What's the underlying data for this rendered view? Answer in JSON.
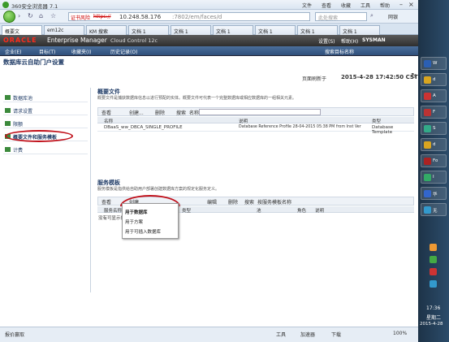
{
  "browser": {
    "title": "360安全浏览器 7.1",
    "menus": [
      "文件",
      "查看",
      "收藏",
      "工具",
      "帮助"
    ],
    "url_warning": "证书风险",
    "url_scheme": "https://",
    "url_host": "10.248.58.176",
    "url_rest": ":7802/em/faces/d",
    "search_placeholder": "此处搜索",
    "speed_label": "网银"
  },
  "tabs": [
    "概要文",
    "em12c",
    "KM 搜索",
    "文档 1",
    "文档 1",
    "文档 1",
    "文档 1",
    "文档 1",
    "文档 1"
  ],
  "oracle": {
    "logo": "ORACLE",
    "product": "Enterprise Manager",
    "edition": "Cloud Control 12c",
    "settings": "设置(S)",
    "help": "帮助(H)",
    "user": "SYSMAN",
    "search_target": "搜索目标名称"
  },
  "menu": {
    "enterprise": "企业(E)",
    "targets": "目标(T)",
    "favorites": "收藏夹(I)",
    "history": "历史记录(O)"
  },
  "page": {
    "title": "数据库云自助门户设置",
    "refresh_label": "页面刷新于",
    "refresh_time": "2015-4-28 17:42:50 CST"
  },
  "sidebar": [
    "数据库池",
    "请求设置",
    "限额",
    "概要文件和服务模板",
    "计费"
  ],
  "profiles": {
    "title": "概要文件",
    "desc": "概要文件是捕获数据库信息以进行预配的实体。概要文件可代表一个完整数据库或相应数据库的一组相关元素。",
    "view": "查看",
    "create": "创建...",
    "delete": "删除",
    "search": "搜索",
    "search_field": "名称",
    "columns": [
      "名称",
      "说明",
      "类型"
    ],
    "row": {
      "name": "DBaaS_ww_DBCA_SINGLE_PROFILE",
      "desc": "Database Reference Profile 28-04-2015 05:38 PM from Inst Ver",
      "type": "Database Template"
    }
  },
  "templates": {
    "title": "服务模板",
    "desc": "服务模板是指供给自助用户部署创建数据库方案的规定化服务定义。",
    "view": "查看",
    "create": "创建",
    "edit": "编辑",
    "delete": "删除",
    "search": "搜索",
    "search_field": "按服务模板名称",
    "columns": [
      "服务名称",
      "类型",
      "池",
      "角色",
      "说明"
    ],
    "empty": "没有可显示的数据"
  },
  "dropdown": [
    "用于数据库",
    "用于方案",
    "用于可插入数据库"
  ],
  "status": {
    "left": "报价赢取",
    "zoom": "100%",
    "items": [
      "工具",
      "加速器",
      "下载"
    ]
  },
  "taskbar": {
    "items": [
      "W",
      "d",
      "A",
      "F",
      "S",
      "d",
      "Fo",
      "I",
      "华",
      "无"
    ],
    "time": "17:36",
    "weekday": "星期二",
    "date": "2015-4-28"
  }
}
